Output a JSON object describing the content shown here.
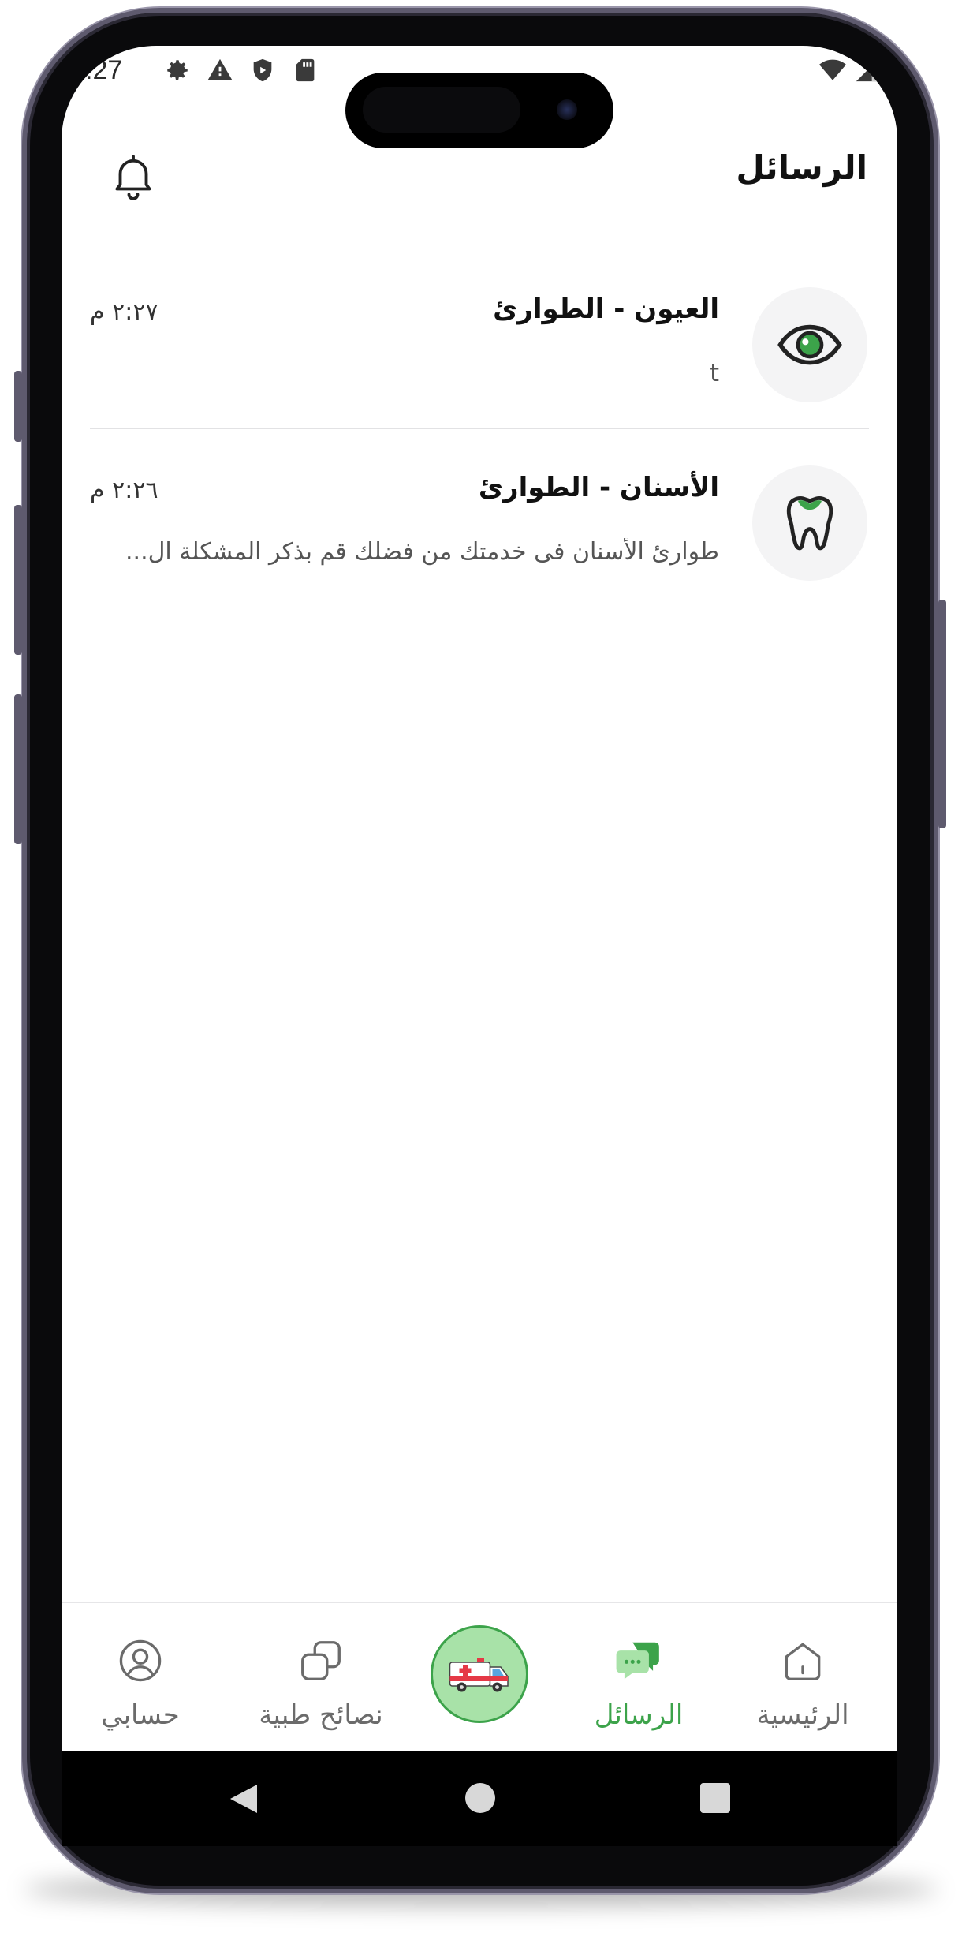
{
  "status_bar": {
    "time": ".27",
    "icons": [
      "gear-icon",
      "warning-icon",
      "shield-icon",
      "sd-card-icon"
    ],
    "right_icons": [
      "wifi-icon",
      "signal-icon"
    ]
  },
  "header": {
    "title": "الرسائل",
    "bell_icon": "bell-icon"
  },
  "messages": [
    {
      "title": "العيون - الطوارئ",
      "time": "٢:٢٧ م",
      "preview": "t",
      "icon": "eye-icon"
    },
    {
      "title": "الأسنان - الطوارئ",
      "time": "٢:٢٦ م",
      "preview": "طوارئ الأسنان فى خدمتك من فضلك قم بذكر المشكلة ال...",
      "icon": "tooth-icon"
    }
  ],
  "bottom_nav": {
    "home": "الرئيسية",
    "messages": "الرسائل",
    "center": "ambulance-icon",
    "tips": "نصائح طبية",
    "account": "حسابي",
    "active": "messages"
  },
  "colors": {
    "accent": "#3ca34a",
    "accent_light": "#a8e2a8",
    "frame": "#5e5a6e"
  }
}
